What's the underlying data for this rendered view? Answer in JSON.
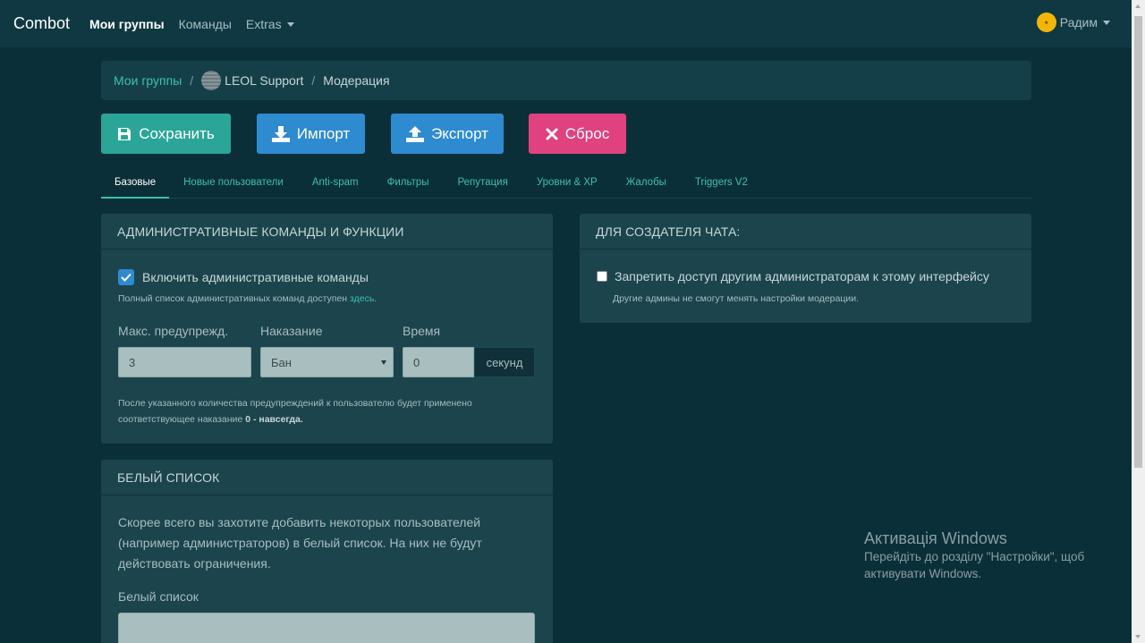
{
  "navbar": {
    "brand": "Combot",
    "links": [
      "Мои группы",
      "Команды",
      "Extras"
    ],
    "user_name": "Радим"
  },
  "breadcrumb": {
    "root": "Мои группы",
    "group": "LEOL Support",
    "current": "Модерация",
    "separator": "/"
  },
  "toolbar": {
    "save": "Сохранить",
    "import": "Импорт",
    "export": "Экспорт",
    "reset": "Сброс"
  },
  "tabs": [
    "Базовые",
    "Новые пользователи",
    "Anti-spam",
    "Фильтры",
    "Репутация",
    "Уровни & XP",
    "Жалобы",
    "Triggers V2"
  ],
  "admin_panel": {
    "title": "АДМИНИСТРАТИВНЫЕ КОМАНДЫ И ФУНКЦИИ",
    "enable_label": "Включить административные команды",
    "enable_checked": true,
    "note_prefix": "Полный список административных команд доступен ",
    "note_link": "здесь",
    "note_suffix": ".",
    "max_warn_label": "Макс. предупрежд.",
    "max_warn_value": "3",
    "punish_label": "Наказание",
    "punish_value": "Бан",
    "time_label": "Время",
    "time_value": "0",
    "time_unit": "секунд",
    "help_text": "После указанного количества предупреждений к пользователю будет применено соответствующее наказание ",
    "help_bold": "0 - навсегда."
  },
  "creator_panel": {
    "title": "ДЛЯ СОЗДАТЕЛЯ ЧАТА:",
    "restrict_label": "Запретить доступ другим администраторам к этому интерфейсу",
    "restrict_checked": false,
    "restrict_note": "Другие админы не смогут менять настройки модерации."
  },
  "whitelist_panel": {
    "title": "БЕЛЫЙ СПИСОК",
    "description": "Скорее всего вы захотите добавить некоторых пользователей (например администраторов) в белый список. На них не будут действовать ограничения.",
    "field_label": "Белый список"
  },
  "watermark": {
    "title": "Активація Windows",
    "line1": "Перейдіть до розділу \"Настройки\", щоб",
    "line2": "активувати Windows."
  },
  "colors": {
    "background": "#0b2f38",
    "accent": "#3bc0b0",
    "save": "#2aa598",
    "import_export": "#2e8bd0",
    "reset": "#e0427f"
  }
}
